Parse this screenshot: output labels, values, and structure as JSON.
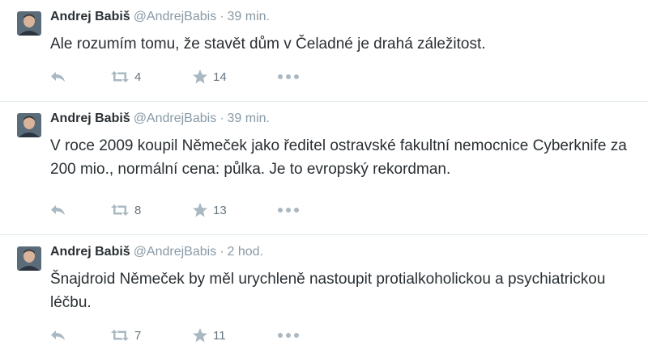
{
  "tweets": [
    {
      "name": "Andrej Babiš",
      "handle": "@AndrejBabis",
      "separator": "·",
      "time": "39 min.",
      "text": "Ale rozumím tomu, že stavět dům v Čeladné je drahá záležitost.",
      "retweets": "4",
      "favorites": "14"
    },
    {
      "name": "Andrej Babiš",
      "handle": "@AndrejBabis",
      "separator": "·",
      "time": "39 min.",
      "text": "V roce 2009 koupil Němeček jako ředitel ostravské fakultní nemocnice Cyberknife za 200 mio., normální cena: půlka. Je to evropský rekordman.",
      "retweets": "8",
      "favorites": "13"
    },
    {
      "name": "Andrej Babiš",
      "handle": "@AndrejBabis",
      "separator": "·",
      "time": "2 hod.",
      "text": "Šnajdroid Němeček by měl urychleně nastoupit protialkoholickou a psychiatrickou léčbu.",
      "retweets": "7",
      "favorites": "11"
    }
  ],
  "colors": {
    "text": "#292f33",
    "secondary": "#8899a6",
    "icon": "#aab8c2",
    "divider": "#e1e8ed"
  },
  "icons": [
    "avatar",
    "reply-icon",
    "retweet-icon",
    "star-icon",
    "more-icon"
  ]
}
